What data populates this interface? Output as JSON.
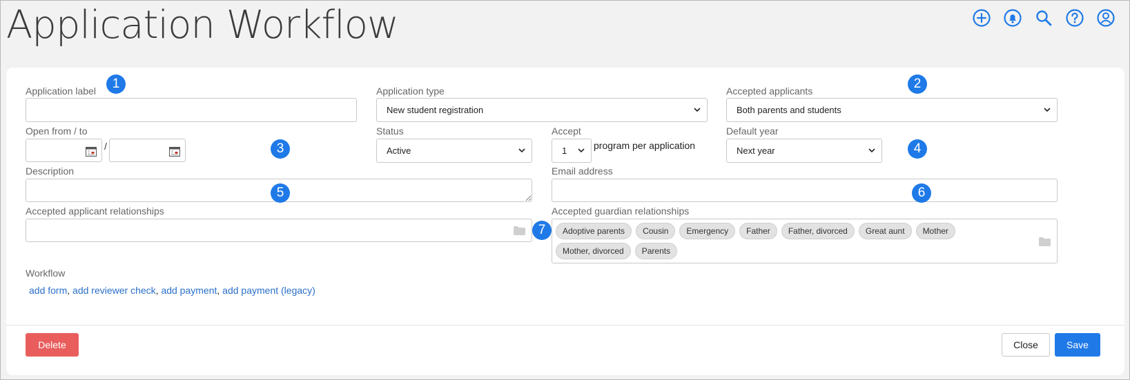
{
  "page": {
    "title": "Application Workflow"
  },
  "header_icons": [
    "add-circle-icon",
    "bell-icon",
    "search-icon",
    "help-icon",
    "user-icon"
  ],
  "colors": {
    "accent": "#1f7ae8",
    "danger": "#e95d5d",
    "link": "#2a6fc9"
  },
  "form": {
    "application_label": {
      "label": "Application label",
      "value": ""
    },
    "application_type": {
      "label": "Application type",
      "value": "New student registration"
    },
    "accepted_applicants": {
      "label": "Accepted applicants",
      "value": "Both parents and students"
    },
    "open_from_to": {
      "label": "Open from / to",
      "separator": "/",
      "from": "",
      "to": ""
    },
    "status": {
      "label": "Status",
      "value": "Active"
    },
    "accept": {
      "label": "Accept",
      "value": "1",
      "suffix": "program per application"
    },
    "default_year": {
      "label": "Default year",
      "value": "Next year"
    },
    "description": {
      "label": "Description",
      "value": ""
    },
    "email_address": {
      "label": "Email address",
      "value": ""
    },
    "accepted_applicant_relationships": {
      "label": "Accepted applicant relationships"
    },
    "accepted_guardian_relationships": {
      "label": "Accepted guardian relationships",
      "tags": [
        "Adoptive parents",
        "Cousin",
        "Emergency",
        "Father",
        "Father, divorced",
        "Great aunt",
        "Mother",
        "Mother, divorced",
        "Parents"
      ]
    },
    "workflow": {
      "label": "Workflow",
      "links": [
        "add form",
        "add reviewer check",
        "add payment",
        "add payment (legacy)"
      ],
      "separator": ", "
    }
  },
  "markers": [
    "1",
    "2",
    "3",
    "4",
    "5",
    "6",
    "7"
  ],
  "footer": {
    "delete": "Delete",
    "close": "Close",
    "save": "Save"
  }
}
